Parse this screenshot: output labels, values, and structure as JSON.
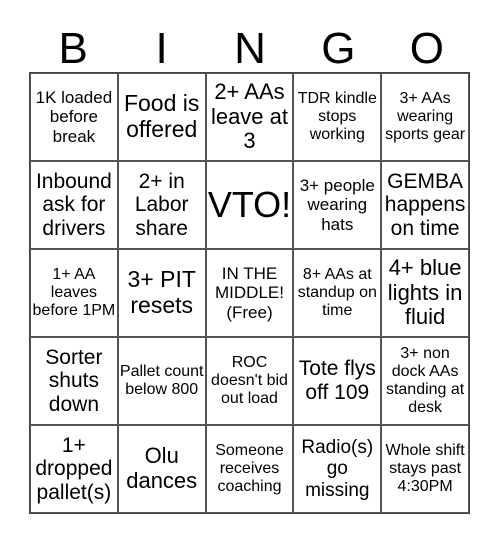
{
  "header": {
    "letters": [
      "B",
      "I",
      "N",
      "G",
      "O"
    ]
  },
  "cells": [
    "1K loaded before break",
    "Food is offered",
    "2+ AAs leave at 3",
    "TDR kindle stops working",
    "3+ AAs wearing sports gear",
    "Inbound ask for drivers",
    "2+ in Labor share",
    "VTO!",
    "3+ people wearing hats",
    "GEMBA happens on time",
    "1+ AA leaves before 1PM",
    "3+ PIT resets",
    "IN THE MIDDLE! (Free)",
    "8+ AAs at standup on time",
    "4+ blue lights in fluid",
    "Sorter shuts down",
    "Pallet count below 800",
    "ROC doesn't bid out load",
    "Tote flys off 109",
    "3+ non dock AAs standing at desk",
    "1+ dropped pallet(s)",
    "Olu dances",
    "Someone receives coaching",
    "Radio(s) go missing",
    "Whole shift stays past 4:30PM"
  ]
}
